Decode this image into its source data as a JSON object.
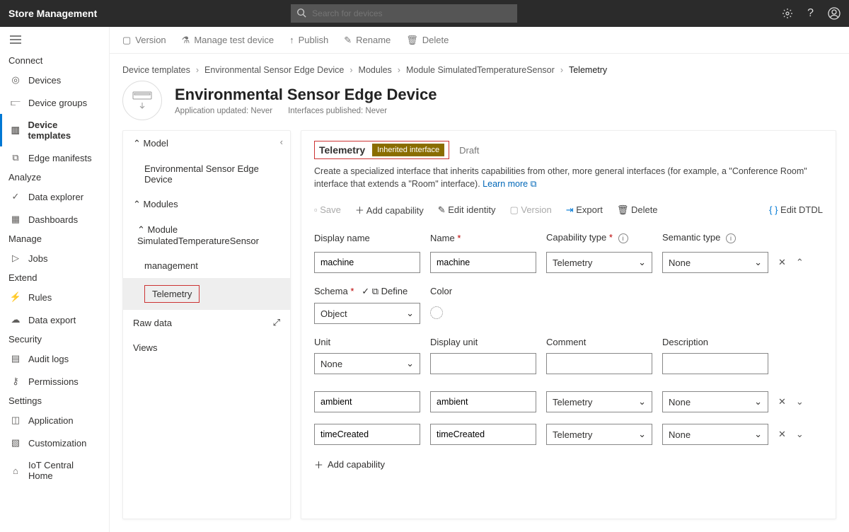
{
  "app_title": "Store Management",
  "search_placeholder": "Search for devices",
  "sidebar": {
    "connect": "Connect",
    "devices": "Devices",
    "device_groups": "Device groups",
    "device_templates": "Device templates",
    "edge_manifests": "Edge manifests",
    "analyze": "Analyze",
    "data_explorer": "Data explorer",
    "dashboards": "Dashboards",
    "manage": "Manage",
    "jobs": "Jobs",
    "extend": "Extend",
    "rules": "Rules",
    "data_export": "Data export",
    "security": "Security",
    "audit_logs": "Audit logs",
    "permissions": "Permissions",
    "settings": "Settings",
    "application": "Application",
    "customization": "Customization",
    "iot_home": "IoT Central Home"
  },
  "commands": {
    "version": "Version",
    "manage_test": "Manage test device",
    "publish": "Publish",
    "rename": "Rename",
    "delete": "Delete"
  },
  "crumbs": {
    "a": "Device templates",
    "b": "Environmental Sensor Edge Device",
    "c": "Modules",
    "d": "Module SimulatedTemperatureSensor",
    "e": "Telemetry"
  },
  "page_title": "Environmental Sensor Edge Device",
  "sub1": "Application updated: Never",
  "sub2": "Interfaces published: Never",
  "tree": {
    "model": "Model",
    "env": "Environmental Sensor Edge Device",
    "modules": "Modules",
    "mod": "Module SimulatedTemperatureSensor",
    "mgmt": "management",
    "tel": "Telemetry",
    "raw": "Raw data",
    "views": "Views"
  },
  "panel": {
    "name": "Telemetry",
    "badge": "Inherited interface",
    "draft": "Draft",
    "desc1": "Create a specialized interface that inherits capabilities from other, more general interfaces (for example, a \"Conference Room\" interface that extends a \"Room\" interface). ",
    "learn": "Learn more"
  },
  "toolbar": {
    "save": "Save",
    "add": "Add capability",
    "edit": "Edit identity",
    "version": "Version",
    "export": "Export",
    "delete": "Delete",
    "dtdl": "Edit DTDL"
  },
  "cols": {
    "disp": "Display name",
    "name": "Name",
    "cap": "Capability type",
    "sem": "Semantic type"
  },
  "rows": {
    "r1_disp": "machine",
    "r1_name": "machine",
    "r1_cap": "Telemetry",
    "r1_sem": "None",
    "r2_disp": "ambient",
    "r2_name": "ambient",
    "r2_cap": "Telemetry",
    "r2_sem": "None",
    "r3_disp": "timeCreated",
    "r3_name": "timeCreated",
    "r3_cap": "Telemetry",
    "r3_sem": "None"
  },
  "exp": {
    "schema": "Schema",
    "define": "Define",
    "color": "Color",
    "schema_val": "Object",
    "unit": "Unit",
    "dispunit": "Display unit",
    "comment": "Comment",
    "description": "Description",
    "unit_val": "None"
  },
  "add_cap": "Add capability"
}
